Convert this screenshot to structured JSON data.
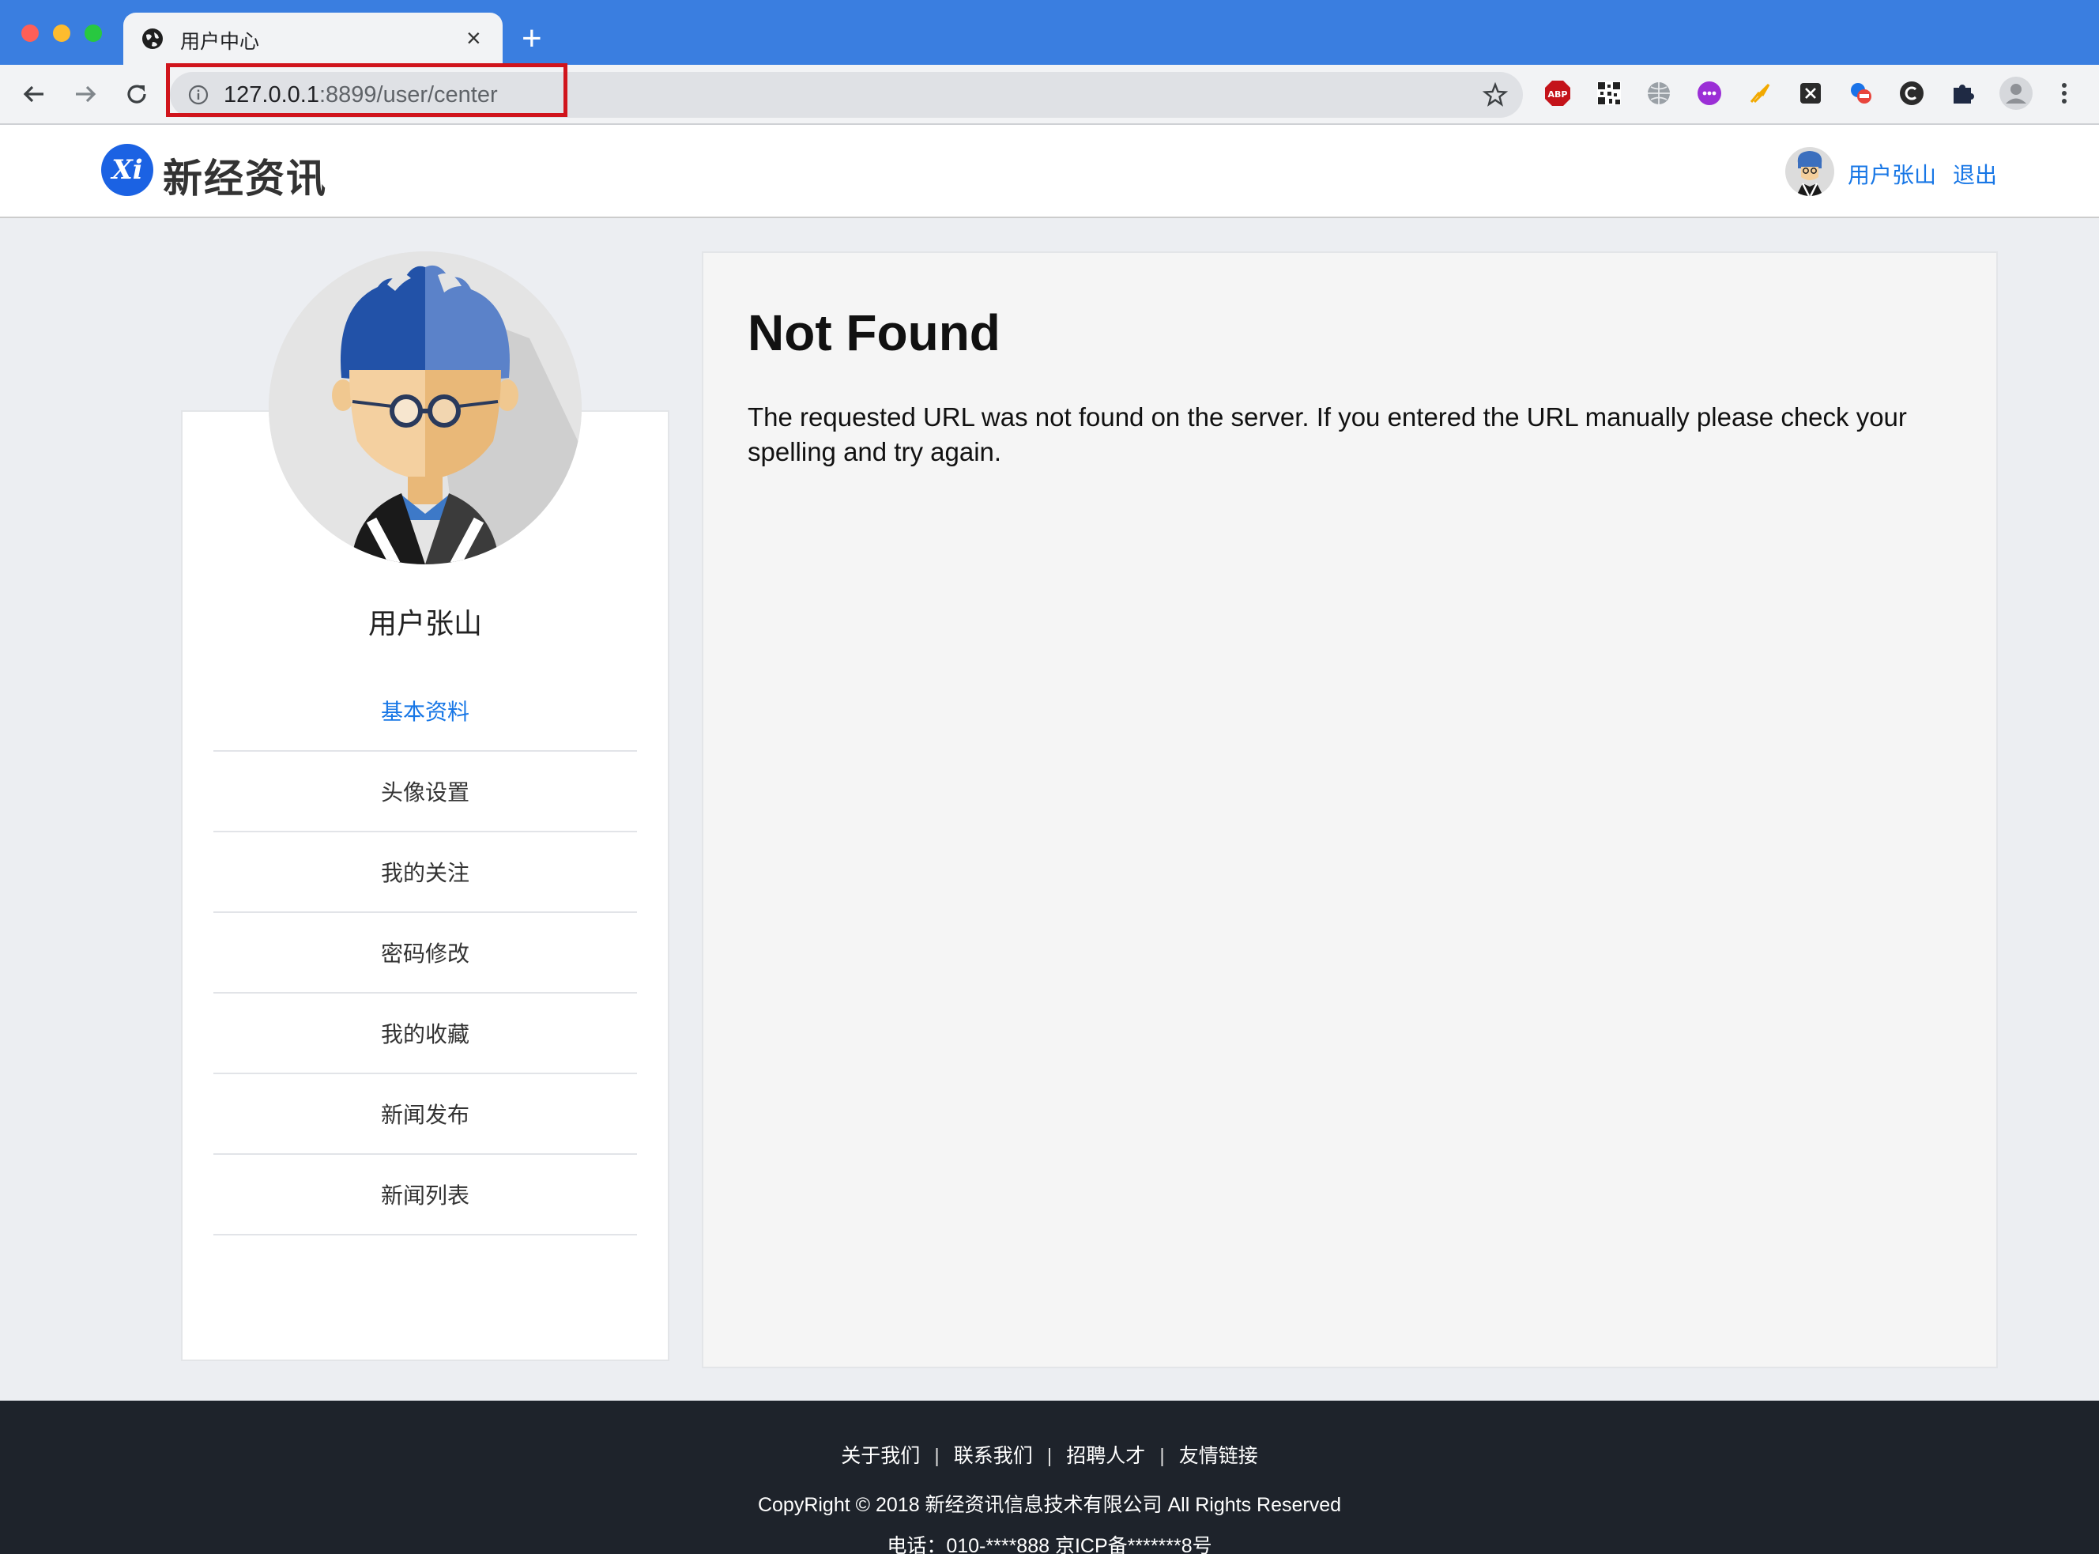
{
  "browser": {
    "tab_title": "用户中心",
    "url_host": "127.0.0.1",
    "url_path": ":8899/user/center",
    "new_tab_label": "+",
    "close_label": "×"
  },
  "site": {
    "logo_mark": "Xi",
    "logo_text": "新经资讯",
    "header_user": "用户张山",
    "header_logout": "退出"
  },
  "sidebar": {
    "user_name": "用户张山",
    "items": [
      {
        "label": "基本资料",
        "active": true
      },
      {
        "label": "头像设置"
      },
      {
        "label": "我的关注"
      },
      {
        "label": "密码修改"
      },
      {
        "label": "我的收藏"
      },
      {
        "label": "新闻发布"
      },
      {
        "label": "新闻列表"
      }
    ]
  },
  "main": {
    "title": "Not Found",
    "message": "The requested URL was not found on the server. If you entered the URL manually please check your spelling and try again."
  },
  "footer": {
    "links": [
      "关于我们",
      "联系我们",
      "招聘人才",
      "友情链接"
    ],
    "separator": "|",
    "copyright": "CopyRight © 2018 新经资讯信息技术有限公司 All Rights Reserved",
    "phone": "电话：010-****888 京ICP备*******8号"
  },
  "colors": {
    "chrome_blue": "#3a7ee0",
    "link_blue": "#1877e6",
    "footer_bg": "#1e232b",
    "highlight_red": "#d0141c"
  }
}
